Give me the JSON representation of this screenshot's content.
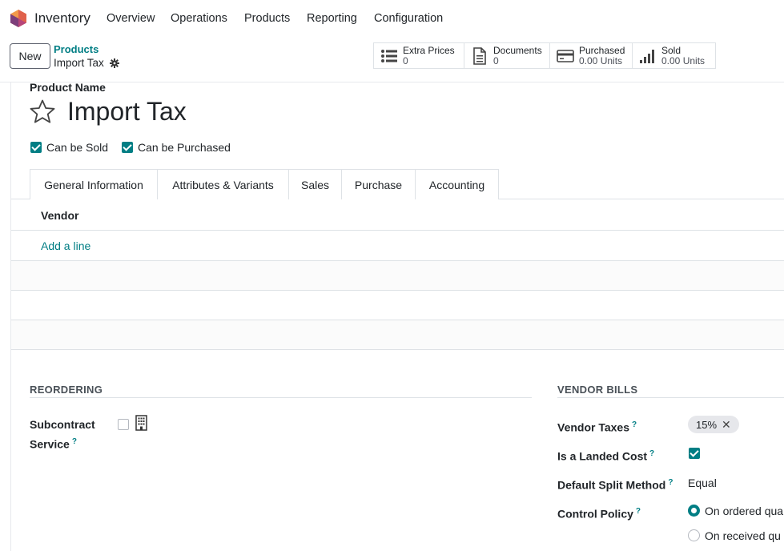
{
  "navbar": {
    "app_name": "Inventory",
    "menu": [
      "Overview",
      "Operations",
      "Products",
      "Reporting",
      "Configuration"
    ]
  },
  "control_panel": {
    "new_label": "New",
    "breadcrumb_parent": "Products",
    "breadcrumb_current": "Import Tax",
    "smart_buttons": [
      {
        "label": "Extra Prices",
        "value": "0",
        "icon": "list-icon"
      },
      {
        "label": "Documents",
        "value": "0",
        "icon": "document-icon"
      },
      {
        "label": "Purchased",
        "value": "0.00 Units",
        "icon": "credit-card-icon"
      },
      {
        "label": "Sold",
        "value": "0.00 Units",
        "icon": "signal-bars-icon"
      }
    ]
  },
  "form": {
    "product_name_label": "Product Name",
    "product_name": "Import Tax",
    "can_be_sold_label": "Can be Sold",
    "can_be_purchased_label": "Can be Purchased",
    "tabs": [
      "General Information",
      "Attributes & Variants",
      "Sales",
      "Purchase",
      "Accounting"
    ],
    "active_tab": "Purchase",
    "vendor_column": "Vendor",
    "add_line": "Add a line",
    "reordering": {
      "title": "REORDERING",
      "subcontract_label_1": "Subcontract",
      "subcontract_label_2": "Service",
      "help_mark": "?"
    },
    "vendor_bills": {
      "title": "VENDOR BILLS",
      "vendor_taxes_label": "Vendor Taxes",
      "vendor_tax_tag": "15%",
      "tag_remove": "✕",
      "landed_cost_label": "Is a Landed Cost",
      "split_method_label": "Default Split Method",
      "split_method_value": "Equal",
      "control_policy_label": "Control Policy",
      "policy_option_1": "On ordered qua",
      "policy_option_2": "On received qu",
      "help_mark": "?"
    }
  },
  "colors": {
    "accent": "#017e84",
    "logo_orange": "#f2994a",
    "logo_purple": "#7c3e7a"
  }
}
